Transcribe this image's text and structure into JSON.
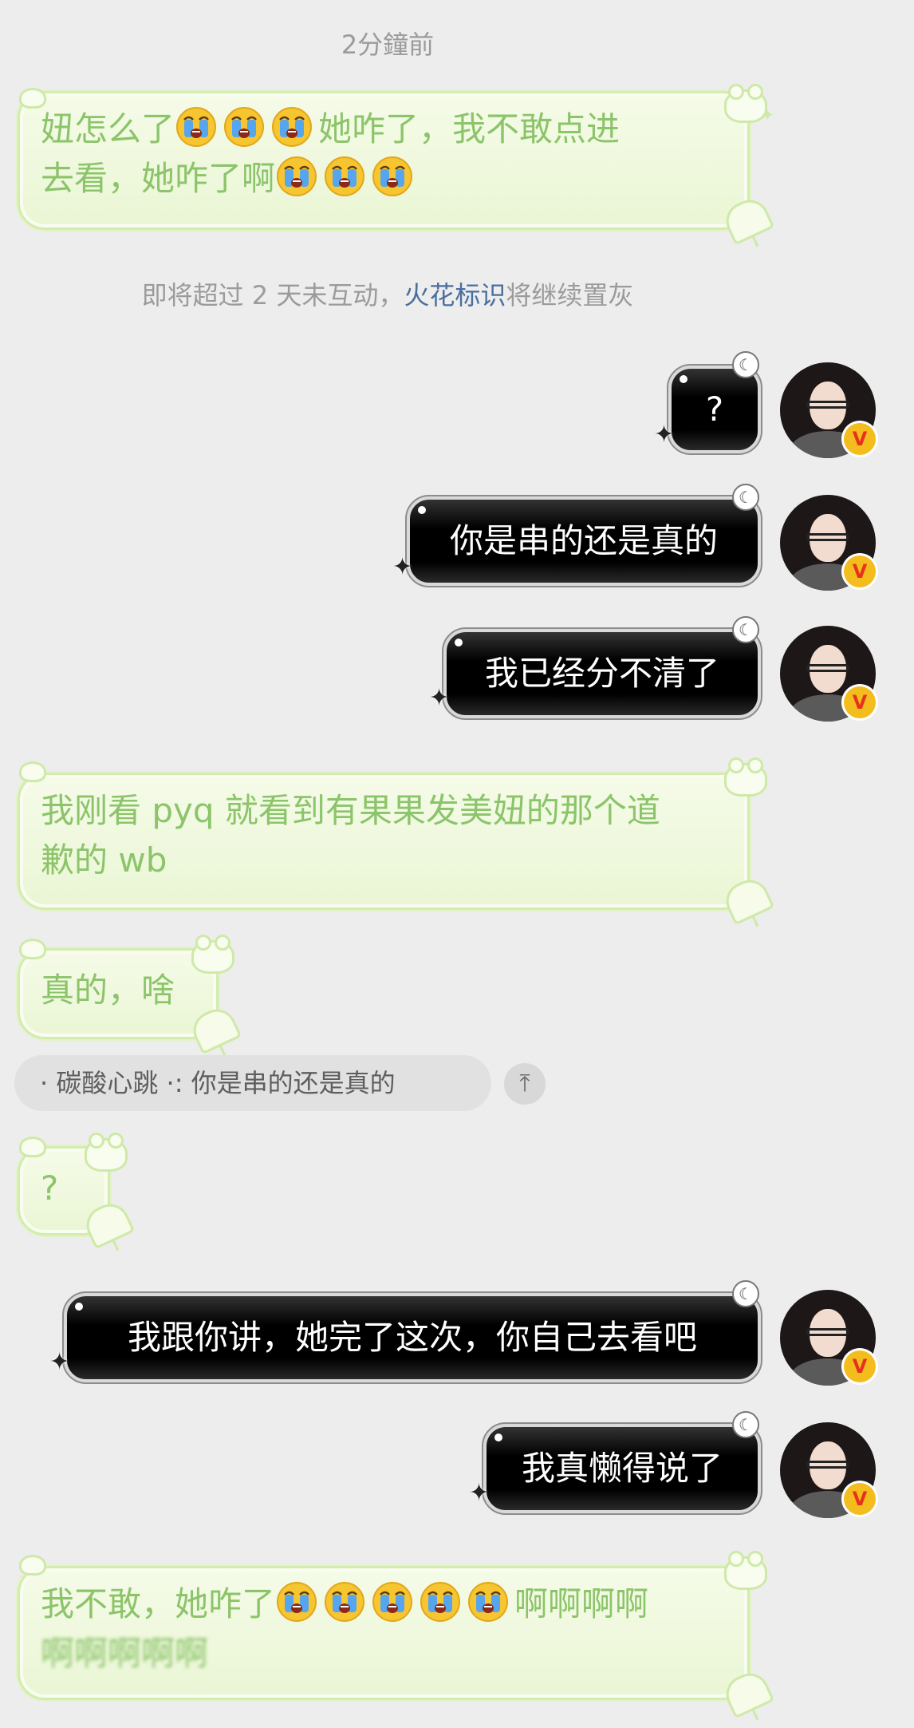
{
  "timestamp": "2分鐘前",
  "system_notice": {
    "before": "即将超过 2 天未互动，",
    "link": "火花标识",
    "after": "将继续置灰"
  },
  "messages": [
    {
      "id": 1,
      "side": "incoming",
      "text_parts": [
        "妞怎么了",
        "[crying-emoji]",
        "[crying-emoji]",
        "[crying-emoji]",
        "她咋了，我不敢点进去看，她咋了啊",
        "[crying-emoji]",
        "[crying-emoji]",
        "[crying-emoji]"
      ]
    },
    {
      "id": 2,
      "side": "outgoing",
      "text": "?"
    },
    {
      "id": 3,
      "side": "outgoing",
      "text": "你是串的还是真的"
    },
    {
      "id": 4,
      "side": "outgoing",
      "text": "我已经分不清了"
    },
    {
      "id": 5,
      "side": "incoming",
      "text": "我刚看 pyq 就看到有果果发美妞的那个道歉的 wb"
    },
    {
      "id": 6,
      "side": "incoming",
      "text": "真的，啥"
    },
    {
      "id": 7,
      "side": "incoming",
      "text": "?"
    },
    {
      "id": 8,
      "side": "outgoing",
      "text": "我跟你讲，她完了这次，你自己去看吧"
    },
    {
      "id": 9,
      "side": "outgoing",
      "text": "我真懒得说了"
    },
    {
      "id": 10,
      "side": "incoming",
      "text_parts": [
        "我不敢，她咋了",
        "[crying-emoji]",
        "[crying-emoji]",
        "[crying-emoji]",
        "[crying-emoji]",
        "[crying-emoji]",
        "啊啊啊啊啊啊啊啊啊"
      ]
    }
  ],
  "texts": {
    "m1_a": "妞怎么了",
    "m1_b": "她咋了，我不敢点进",
    "m1_c": "去看，她咋了啊",
    "m2": "?",
    "m3": "你是串的还是真的",
    "m4": "我已经分不清了",
    "m5_a": "我刚看 pyq 就看到有果果发美妞的那个道",
    "m5_b": "歉的 wb",
    "m6": "真的，啥",
    "m7": "?",
    "m8": "我跟你讲，她完了这次，你自己去看吧",
    "m9": "我真懒得说了",
    "m10_a": "我不敢，她咋了",
    "m10_b": "啊啊啊啊",
    "m10_c": "啊啊啊啊啊"
  },
  "quote_reply": {
    "text": "· 碳酸心跳 ·: 你是串的还是真的",
    "pin_icon": "arrow-up-to-top"
  },
  "avatar_badge": "V",
  "colors": {
    "background": "#ededed",
    "incoming_text": "#8cc46a",
    "incoming_bubble": "#eef8dc",
    "outgoing_bubble": "#000000",
    "outgoing_text": "#ffffff",
    "link": "#4a6f9e",
    "badge": "#f4bd1e"
  }
}
